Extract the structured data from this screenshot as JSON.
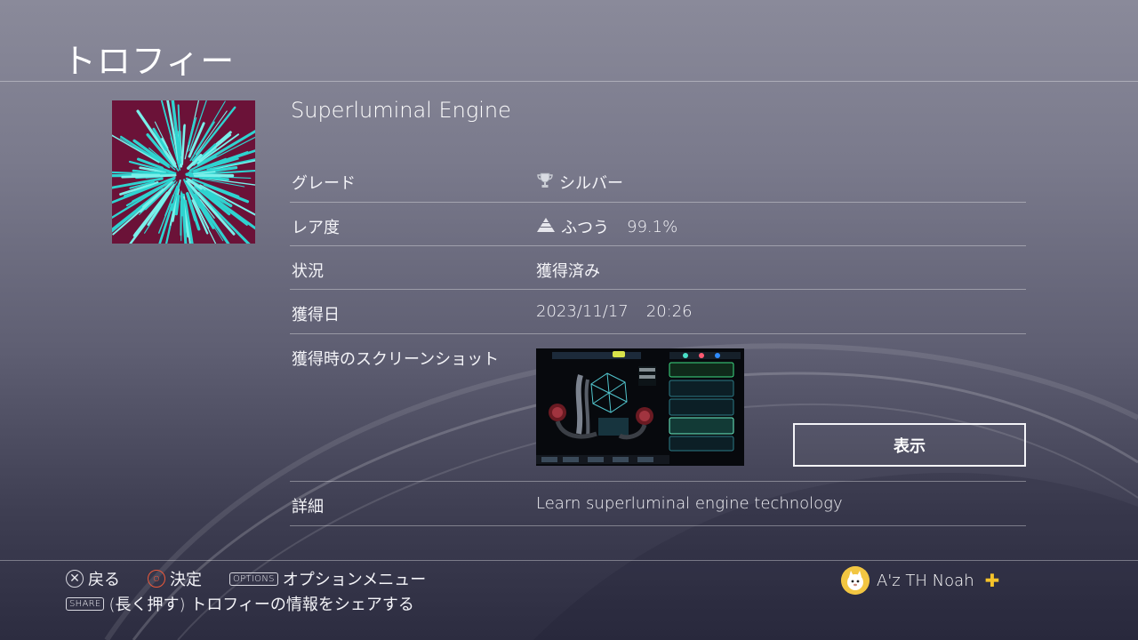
{
  "header": {
    "title": "トロフィー"
  },
  "trophy": {
    "name": "Superluminal Engine",
    "rows": {
      "grade": {
        "label": "グレード",
        "value": "シルバー",
        "icon": "silver-trophy-icon"
      },
      "rarity": {
        "label": "レア度",
        "value": "ふつう",
        "percent": "99.1%",
        "icon": "rarity-pyramid-icon"
      },
      "status": {
        "label": "状況",
        "value": "獲得済み"
      },
      "date": {
        "label": "獲得日",
        "date": "2023/11/17",
        "time": "20:26"
      },
      "screenshot": {
        "label": "獲得時のスクリーンショット",
        "button_label": "表示"
      },
      "detail": {
        "label": "詳細",
        "value": "Learn superluminal engine technology"
      }
    }
  },
  "footer": {
    "back": {
      "icon": "cross-button-icon",
      "label": "戻る"
    },
    "confirm": {
      "icon": "circle-button-icon",
      "label": "決定"
    },
    "options": {
      "key": "OPTIONS",
      "label": "オプションメニュー"
    },
    "share": {
      "key": "SHARE",
      "label": "(長く押す) トロフィーの情報をシェアする"
    },
    "user": {
      "name": "A'z TH Noah",
      "plus_icon": "ps-plus-icon"
    }
  },
  "colors": {
    "accent_circle": "#ee5a3a",
    "ps_plus": "#f5c32a",
    "trophy_art_bg": "#6b1238",
    "trophy_art_rays": "#2fd3d0"
  }
}
